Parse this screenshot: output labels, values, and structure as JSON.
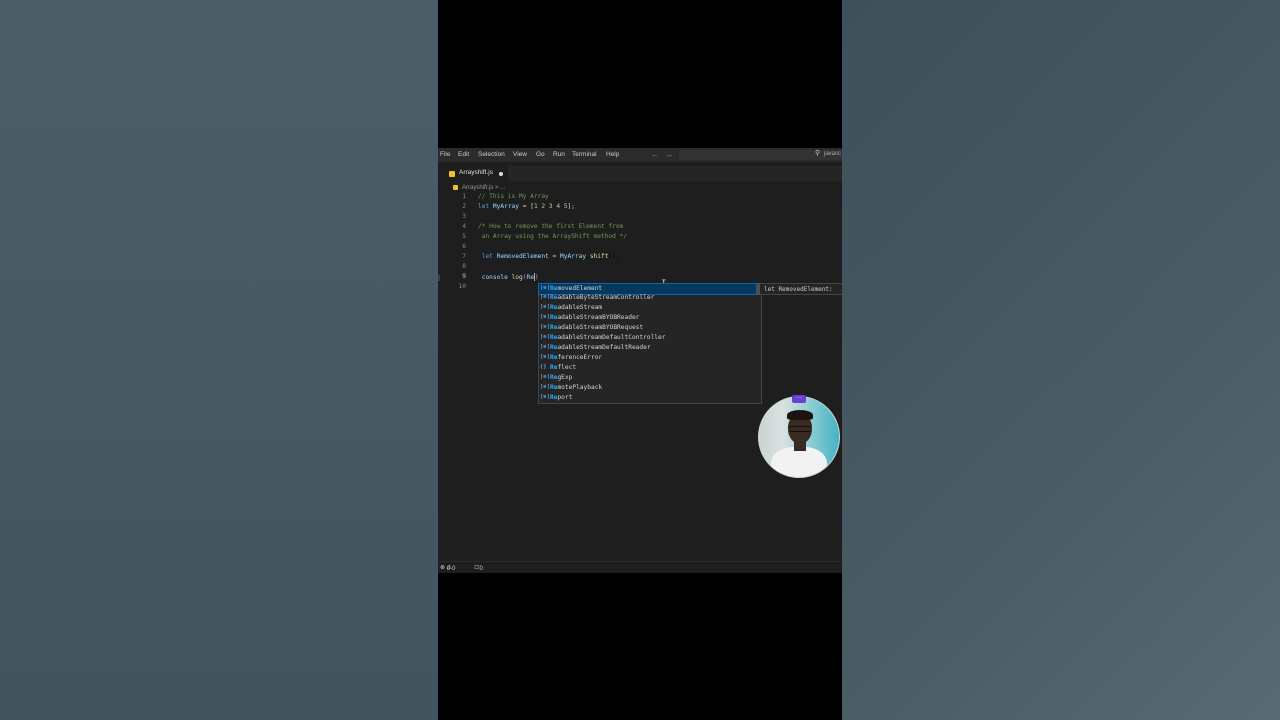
{
  "menu": {
    "items": [
      "File",
      "Edit",
      "Selection",
      "View",
      "Go",
      "Run",
      "Terminal",
      "Help"
    ],
    "back_arrow": "←",
    "forward_arrow": "→",
    "search_icon": "search-icon",
    "command_center_text": "javasc"
  },
  "tab": {
    "label": "Arrayshift.js",
    "modified": true
  },
  "breadcrumb": {
    "text": "Arrayshift.js > ..."
  },
  "editor": {
    "line_numbers": [
      "1",
      "2",
      "3",
      "4",
      "5",
      "6",
      "7",
      "8",
      "9",
      "10"
    ],
    "active_line": "9"
  },
  "suggest": {
    "items": [
      {
        "icon": "[⊕]",
        "match": "Re",
        "rest": "movedElement"
      },
      {
        "icon": "[⊕]",
        "match": "Re",
        "rest": "adableByteStreamController"
      },
      {
        "icon": "[⊕]",
        "match": "Re",
        "rest": "adableStream"
      },
      {
        "icon": "[⊕]",
        "match": "Re",
        "rest": "adableStreamBYOBReader"
      },
      {
        "icon": "[⊕]",
        "match": "Re",
        "rest": "adableStreamBYOBRequest"
      },
      {
        "icon": "[⊕]",
        "match": "Re",
        "rest": "adableStreamDefaultController"
      },
      {
        "icon": "[⊕]",
        "match": "Re",
        "rest": "adableStreamDefaultReader"
      },
      {
        "icon": "[⊕]",
        "match": "Re",
        "rest": "ferenceError"
      },
      {
        "icon": "{}",
        "match": "Re",
        "rest": "flect"
      },
      {
        "icon": "[⊕]",
        "match": "Re",
        "rest": "gExp"
      },
      {
        "icon": "[⊕]",
        "match": "Re",
        "rest": "motePlayback"
      },
      {
        "icon": "[⊕]",
        "match": "Re",
        "rest": "port"
      }
    ],
    "detail": "let RemovedElement:"
  },
  "status": {
    "errors": "0",
    "warnings": "0",
    "ports": "0"
  },
  "colors": {
    "editor_bg": "#1e1e1e",
    "comment": "#6a9955",
    "keyword": "#569cd6",
    "variable": "#9cdcfe",
    "selection": "#04395e",
    "match": "#2aaaff",
    "js_icon": "#e8c230"
  }
}
